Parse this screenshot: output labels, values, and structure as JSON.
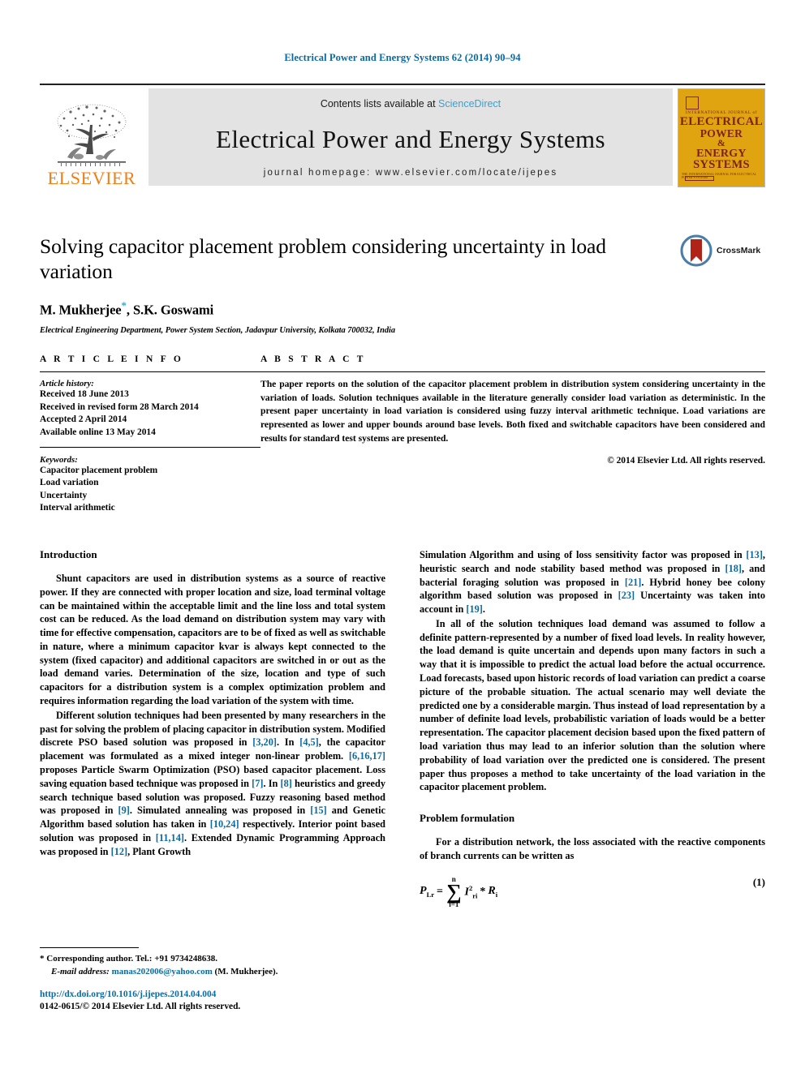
{
  "running_head": "Electrical Power and Energy Systems 62 (2014) 90–94",
  "masthead": {
    "elsevier_wordmark": "ELSEVIER",
    "contents_prefix": "Contents lists available at ",
    "sciencedirect": "ScienceDirect",
    "journal_name": "Electrical Power and Energy Systems",
    "homepage": "journal homepage: www.elsevier.com/locate/ijepes",
    "accent_blue": "#3aa0d1",
    "band_gray": "#e3e3e3",
    "elsevier_orange": "#f07e13",
    "cover": {
      "kicker": "INTERNATIONAL JOURNAL of",
      "line1": "ELECTRICAL",
      "line2": "POWER",
      "line3": "&",
      "line4": "ENERGY",
      "line5": "SYSTEMS",
      "footer": "THE INTERNATIONAL JOURNAL FOR ELECTRICAL POWER SYSTEMS",
      "bg_color": "#e0a411",
      "text_color": "#7d2318"
    }
  },
  "article": {
    "title": "Solving capacitor placement problem considering uncertainty in load variation",
    "authors": "M. Mukherjee",
    "authors_rest": ", S.K. Goswami",
    "corresponding_marker": "*",
    "affiliation": "Electrical Engineering Department, Power System Section, Jadavpur University, Kolkata 700032, India",
    "crossmark_label": "CrossMark"
  },
  "article_info": {
    "heading": "A R T I C L E   I N F O",
    "history_label": "Article history:",
    "history": [
      "Received 18 June 2013",
      "Received in revised form 28 March 2014",
      "Accepted 2 April 2014",
      "Available online 13 May 2014"
    ],
    "keywords_label": "Keywords:",
    "keywords": [
      "Capacitor placement problem",
      "Load variation",
      "Uncertainty",
      "Interval arithmetic"
    ]
  },
  "abstract": {
    "heading": "A B S T R A C T",
    "text": "The paper reports on the solution of the capacitor placement problem in distribution system considering uncertainty in the variation of loads. Solution techniques available in the literature generally consider load variation as deterministic. In the present paper uncertainty in load variation is considered using fuzzy interval arithmetic technique. Load variations are represented as lower and upper bounds around base levels. Both fixed and switchable capacitors have been considered and results for standard test systems are presented.",
    "rights": "© 2014 Elsevier Ltd. All rights reserved."
  },
  "body": {
    "left": {
      "heading": "Introduction",
      "para1": "Shunt capacitors are used in distribution systems as a source of reactive power. If they are connected with proper location and size, load terminal voltage can be maintained within the acceptable limit and the line loss and total system cost can be reduced. As the load demand on distribution system may vary with time for effective compensation, capacitors are to be of fixed as well as switchable in nature, where a minimum capacitor kvar is always kept connected to the system (fixed capacitor) and additional capacitors are switched in or out as the load demand varies. Determination of the size, location and type of such capacitors for a distribution system is a complex optimization problem and requires information regarding the load variation of the system with time.",
      "para2_parts": [
        "Different solution techniques had been presented by many researchers in the past for solving the problem of placing capacitor in distribution system. Modified discrete PSO based solution was proposed in ",
        "[3,20]",
        ". In ",
        "[4,5]",
        ", the capacitor placement was formulated as a mixed integer non-linear problem. ",
        "[6,16,17]",
        " proposes Particle Swarm Optimization (PSO) based capacitor placement. Loss saving equation based technique was proposed in ",
        "[7]",
        ". In ",
        "[8]",
        " heuristics and greedy search technique based solution was proposed. Fuzzy reasoning based method was proposed in ",
        "[9]",
        ". Simulated annealing was proposed in ",
        "[15]",
        " and Genetic Algorithm based solution has taken in ",
        "[10,24]",
        " respectively. Interior point based solution was proposed in ",
        "[11,14]",
        ". Extended Dynamic Programming Approach was proposed in ",
        "[12]",
        ", Plant Growth"
      ]
    },
    "right": {
      "para1_parts": [
        "Simulation Algorithm and using of loss sensitivity factor was proposed in ",
        "[13]",
        ", heuristic search and node stability based method was proposed in ",
        "[18]",
        ", and bacterial foraging solution was proposed in ",
        "[21]",
        ". Hybrid honey bee colony algorithm based solution was proposed in ",
        "[23]",
        " Uncertainty was taken into account in ",
        "[19]",
        "."
      ],
      "para2": "In all of the solution techniques load demand was assumed to follow a definite pattern-represented by a number of fixed load levels. In reality however, the load demand is quite uncertain and depends upon many factors in such a way that it is impossible to predict the actual load before the actual occurrence. Load forecasts, based upon historic records of load variation can predict a coarse picture of the probable situation. The actual scenario may well deviate the predicted one by a considerable margin. Thus instead of load representation by a number of definite load levels, probabilistic variation of loads would be a better representation. The capacitor placement decision based upon the fixed pattern of load variation thus may lead to an inferior solution than the solution where probability of load variation over the predicted one is considered. The present paper thus proposes a method to take uncertainty of the load variation in the capacitor placement problem.",
      "heading2": "Problem formulation",
      "para3": "For a distribution network, the loss associated with the reactive components of branch currents can be written as",
      "equation": {
        "lhs": "P",
        "lhs_sub": "Lr",
        "eq": "=",
        "sum_upper": "n",
        "sum_lower": "i=1",
        "term": "I",
        "term_sub": "ri",
        "term_sup": "2",
        "operator": "*",
        "factor": "R",
        "factor_sub": "i",
        "number": "(1)"
      }
    }
  },
  "footnote": {
    "marker": "*",
    "corresponding": "Corresponding author. Tel.: +91 9734248638.",
    "email_label": "E-mail address:",
    "email": "manas202006@yahoo.com",
    "email_suffix": "(M. Mukherjee)."
  },
  "footer": {
    "doi": "http://dx.doi.org/10.1016/j.ijepes.2014.04.004",
    "issn_line": "0142-0615/© 2014 Elsevier Ltd. All rights reserved."
  }
}
